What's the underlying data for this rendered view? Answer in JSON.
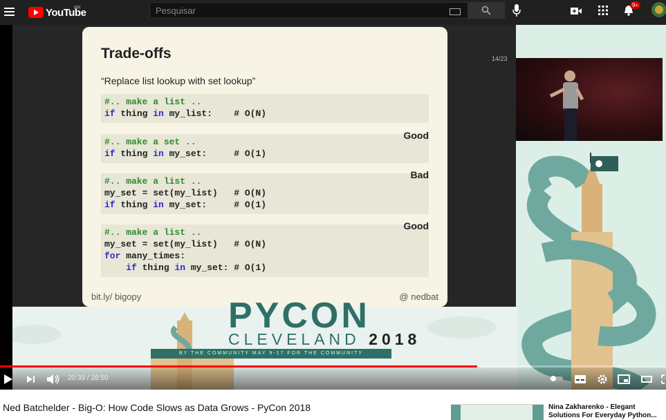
{
  "header": {
    "logo_text": "YouTube",
    "region": "BR",
    "search_placeholder": "Pesquisar",
    "notification_count": "9+",
    "icons": [
      "menu-icon",
      "keyboard-icon",
      "search-icon",
      "mic-icon",
      "create-video-icon",
      "apps-grid-icon",
      "bell-icon",
      "avatar"
    ]
  },
  "slide": {
    "counter": "14/23",
    "title": "Trade-offs",
    "subtitle": "“Replace list lookup with set lookup”",
    "blocks": [
      {
        "label": "",
        "lines": [
          {
            "parts": [
              {
                "t": "#.. make a list ..",
                "c": "c"
              }
            ]
          },
          {
            "parts": [
              {
                "t": "if",
                "c": "k"
              },
              {
                "t": " thing ",
                "c": ""
              },
              {
                "t": "in",
                "c": "k"
              },
              {
                "t": " my_list:    # O(N)",
                "c": ""
              }
            ]
          }
        ]
      },
      {
        "label": "Good",
        "lines": [
          {
            "parts": [
              {
                "t": "#.. make a set ..",
                "c": "c"
              }
            ]
          },
          {
            "parts": [
              {
                "t": "if",
                "c": "k"
              },
              {
                "t": " thing ",
                "c": ""
              },
              {
                "t": "in",
                "c": "k"
              },
              {
                "t": " my_set:     # O(1)",
                "c": ""
              }
            ]
          }
        ]
      },
      {
        "label": "Bad",
        "lines": [
          {
            "parts": [
              {
                "t": "#.. make a list ..",
                "c": "c"
              }
            ]
          },
          {
            "parts": [
              {
                "t": "my_set = set(my_list)   # O(N)",
                "c": ""
              }
            ]
          },
          {
            "parts": [
              {
                "t": "if",
                "c": "k"
              },
              {
                "t": " thing ",
                "c": ""
              },
              {
                "t": "in",
                "c": "k"
              },
              {
                "t": " my_set:     # O(1)",
                "c": ""
              }
            ]
          }
        ]
      },
      {
        "label": "Good",
        "lines": [
          {
            "parts": [
              {
                "t": "#.. make a list ..",
                "c": "c"
              }
            ]
          },
          {
            "parts": [
              {
                "t": "my_set = set(my_list)   # O(N)",
                "c": ""
              }
            ]
          },
          {
            "parts": [
              {
                "t": "for",
                "c": "k"
              },
              {
                "t": " many_times:",
                "c": ""
              }
            ]
          },
          {
            "parts": [
              {
                "t": "    ",
                "c": ""
              },
              {
                "t": "if",
                "c": "k"
              },
              {
                "t": " thing ",
                "c": ""
              },
              {
                "t": "in",
                "c": "k"
              },
              {
                "t": " my_set: # O(1)",
                "c": ""
              }
            ]
          }
        ]
      }
    ],
    "footer_left": "bit.ly/ bigopy",
    "footer_right": "@ nedbat"
  },
  "banner": {
    "pycon": "PYCON",
    "city": "CLEVELAND",
    "year": "2018",
    "ribbon": "BY THE COMMUNITY    MAY 9-17    FOR THE COMMUNITY"
  },
  "player": {
    "time_current": "20:39",
    "time_total": "28:50",
    "time_display": "20:39 / 28:50",
    "progress": 0.716,
    "accent": "#ff0000"
  },
  "video": {
    "title": "Ned Batchelder - Big-O: How Code Slows as Data Grows - PyCon 2018"
  },
  "recommendation": {
    "title": "Nina Zakharenko - Elegant Solutions For Everyday Python..."
  }
}
